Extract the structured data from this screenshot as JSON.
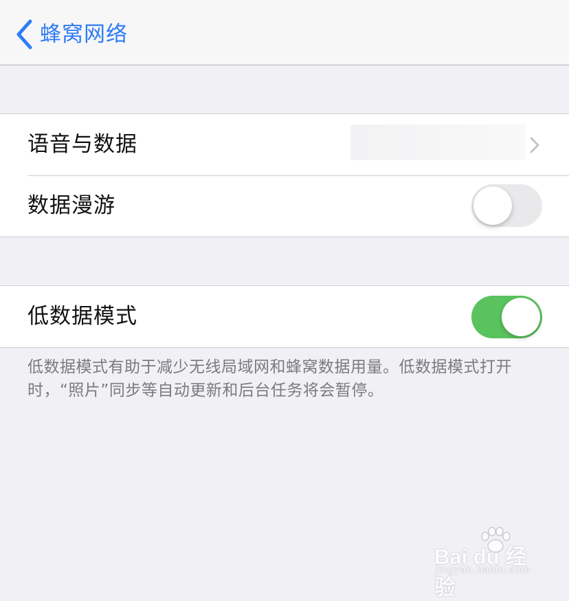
{
  "navbar": {
    "back_label": "蜂窝网络",
    "back_icon": "chevron-left-icon",
    "accent_color": "#2f7cf6"
  },
  "group1": {
    "rows": [
      {
        "label": "语音与数据",
        "value": "",
        "icon": "chevron-right-icon"
      },
      {
        "label": "数据漫游",
        "toggle": "off"
      }
    ]
  },
  "group2": {
    "rows": [
      {
        "label": "低数据模式",
        "toggle": "on"
      }
    ],
    "footer": "低数据模式有助于减少无线局域网和蜂窝数据用量。低数据模式打开时，“照片”同步等自动更新和后台任务将会暂停。"
  },
  "watermark": {
    "brand": "Bai du 经验",
    "url": "jingyan.baidu.com"
  },
  "colors": {
    "background": "#f1f0f5",
    "toggle_on": "#5ac35d",
    "toggle_off": "#e9e9eb"
  }
}
